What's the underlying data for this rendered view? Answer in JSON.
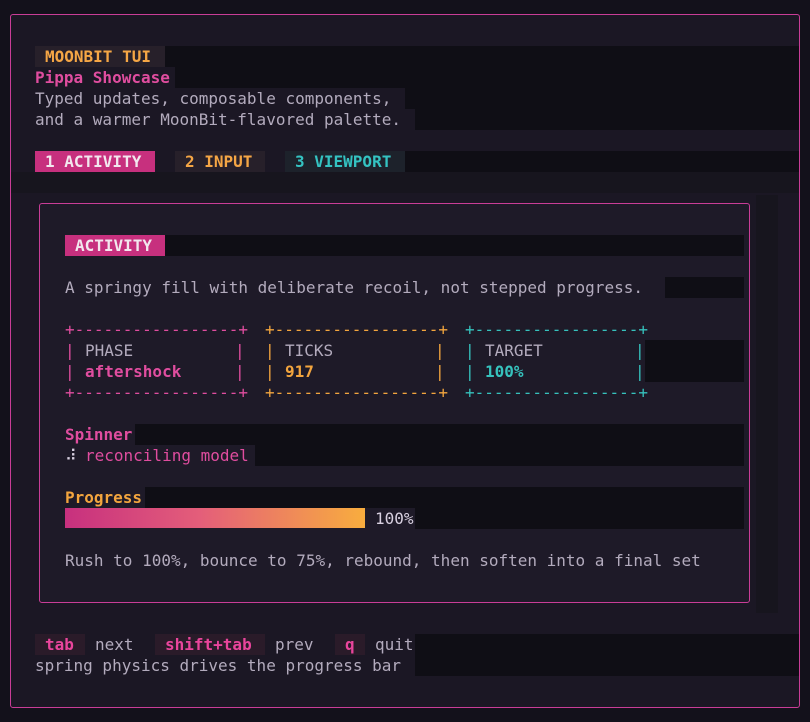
{
  "header": {
    "badge": "MOONBIT TUI",
    "title": "Pippa Showcase",
    "subtitle_line1": "Typed updates, composable components,",
    "subtitle_line2": "and a warmer MoonBit-flavored palette."
  },
  "tabs": [
    {
      "label": "1 ACTIVITY",
      "active": true
    },
    {
      "label": "2 INPUT",
      "active": false
    },
    {
      "label": "3 VIEWPORT",
      "active": false
    }
  ],
  "panel": {
    "badge": "ACTIVITY",
    "description": "A springy fill with deliberate recoil, not stepped progress.",
    "stats": [
      {
        "label": "PHASE",
        "value": "aftershock",
        "color": "#e04d9f"
      },
      {
        "label": "TICKS",
        "value": "917",
        "color": "#f3a53e"
      },
      {
        "label": "TARGET",
        "value": "100%",
        "color": "#36c2bd"
      }
    ],
    "spinner": {
      "heading": "Spinner",
      "glyph": "⠼",
      "text": "reconciling model"
    },
    "progress": {
      "heading": "Progress",
      "value": 1.0,
      "label": "100%",
      "note": "Rush to 100%, bounce to 75%, rebound, then soften into a final set"
    }
  },
  "footer": {
    "keys": [
      {
        "key": "tab",
        "action": "next"
      },
      {
        "key": "shift+tab",
        "action": "prev"
      },
      {
        "key": "q",
        "action": "quit"
      }
    ],
    "hint": "spring physics drives the progress bar"
  },
  "colors": {
    "accent_pink": "#c93d97",
    "accent_orange": "#f3a53e",
    "accent_cyan": "#36c2bd",
    "background": "#13111b"
  }
}
